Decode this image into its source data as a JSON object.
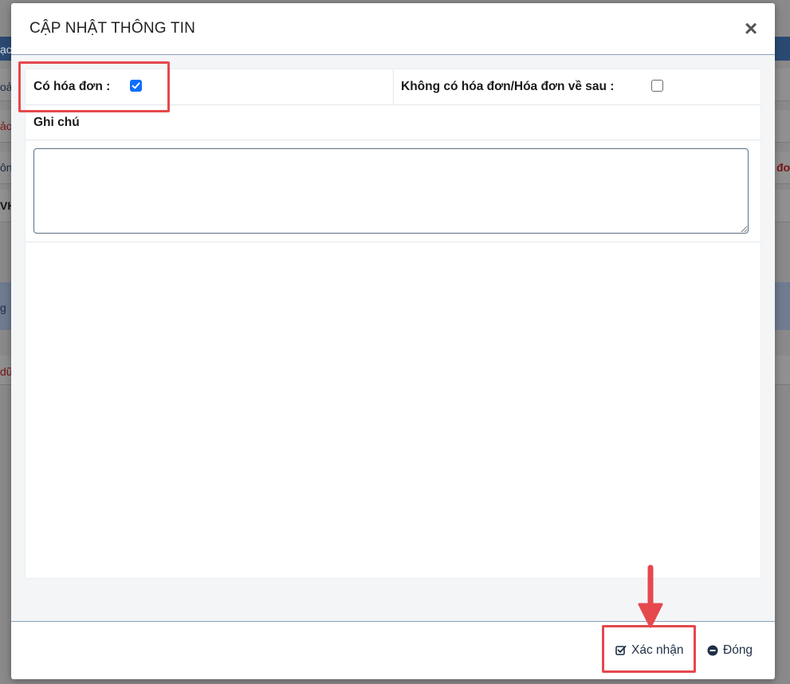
{
  "background": {
    "fragments": [
      "ạc",
      "oả",
      "ảo",
      "ôn",
      "VH",
      "g",
      "dữ",
      "đơ"
    ]
  },
  "modal": {
    "title": "CẬP NHẬT THÔNG TIN",
    "close_glyph": "×",
    "has_invoice_label": "Có hóa đơn :",
    "has_invoice_checked": true,
    "no_invoice_label": "Không có hóa đơn/Hóa đơn về sau :",
    "no_invoice_checked": false,
    "note_label": "Ghi chú",
    "note_value": "",
    "confirm_label": "Xác nhận",
    "close_label": "Đóng"
  },
  "colors": {
    "accent": "#0d6efd",
    "highlight": "#e5484d",
    "button_text": "#1f2f47"
  },
  "icons": {
    "confirm": "check-square-icon",
    "close": "minus-circle-icon",
    "dismiss": "close-icon"
  }
}
